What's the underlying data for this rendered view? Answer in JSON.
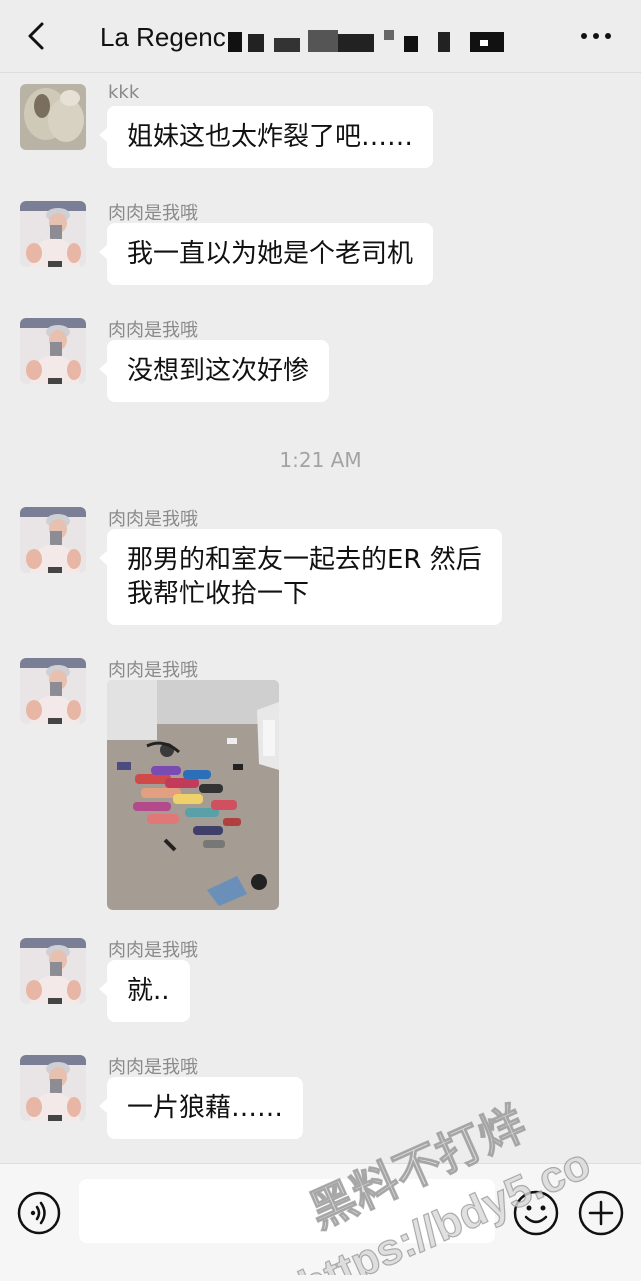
{
  "header": {
    "title": "La Regenc",
    "back_icon": "chevron-left-icon",
    "more_icon": "more-dots-icon"
  },
  "messages": [
    {
      "sender": "kkk",
      "text": "姐妹这也太炸裂了吧……"
    },
    {
      "sender": "肉肉是我哦",
      "text": "我一直以为她是个老司机"
    },
    {
      "sender": "肉肉是我哦",
      "text": "没想到这次好惨"
    },
    {
      "sender": "肉肉是我哦",
      "line1": "那男的和室友一起去的ER 然后",
      "line2": "我帮忙收拾一下"
    },
    {
      "sender": "肉肉是我哦"
    },
    {
      "sender": "肉肉是我哦",
      "text": "就.."
    },
    {
      "sender": "肉肉是我哦",
      "text": "一片狼藉……"
    }
  ],
  "timestamp": "1:21 AM",
  "bottombar": {
    "voice_icon": "voice-icon",
    "emoji_icon": "emoji-icon",
    "plus_icon": "plus-icon"
  },
  "watermark": {
    "line1": "黑料不打烊",
    "line2": "https://bdy5.co"
  },
  "colors": {
    "background": "#ededed",
    "bubble": "#ffffff",
    "secondary_text": "#8a8a8a"
  }
}
